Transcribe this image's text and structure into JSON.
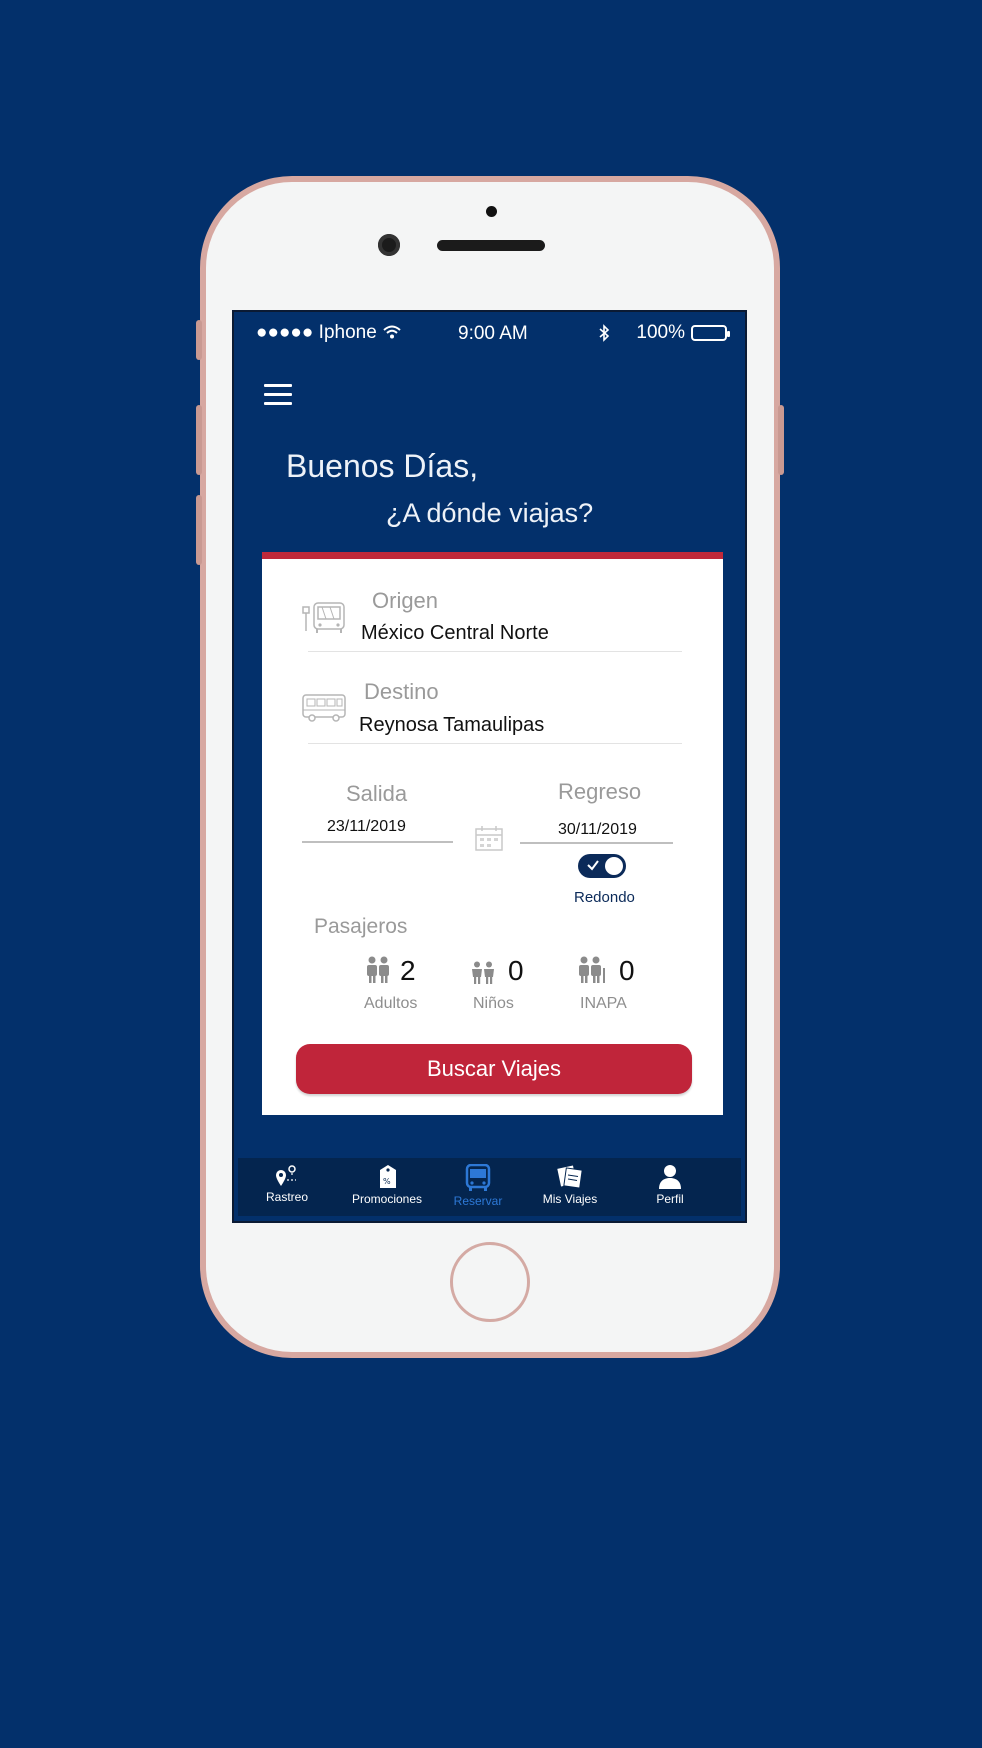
{
  "status_bar": {
    "carrier": "●●●●● Iphone",
    "time": "9:00 AM",
    "battery": "100%"
  },
  "greeting": {
    "line1": "Buenos Días,",
    "line2": "¿A dónde viajas?"
  },
  "form": {
    "origin_label": "Origen",
    "origin_value": "México Central Norte",
    "destination_label": "Destino",
    "destination_value": "Reynosa Tamaulipas",
    "departure_label": "Salida",
    "departure_value": "23/11/2019",
    "return_label": "Regreso",
    "return_value": "30/11/2019",
    "round_trip_label": "Redondo",
    "round_trip_on": true,
    "passengers_label": "Pasajeros",
    "passengers": [
      {
        "label": "Adultos",
        "count": "2"
      },
      {
        "label": "Niños",
        "count": "0"
      },
      {
        "label": "INAPA",
        "count": "0"
      }
    ],
    "search_label": "Buscar Viajes"
  },
  "tabs": [
    {
      "label": "Rastreo",
      "icon": "location-pin-icon",
      "active": false
    },
    {
      "label": "Promociones",
      "icon": "discount-tag-icon",
      "active": false
    },
    {
      "label": "Reservar",
      "icon": "bus-icon",
      "active": true
    },
    {
      "label": "Mis Viajes",
      "icon": "tickets-icon",
      "active": false
    },
    {
      "label": "Perfil",
      "icon": "user-icon",
      "active": false
    }
  ],
  "colors": {
    "background": "#03306b",
    "accent_red": "#c0253a",
    "active_tab": "#2d78d6",
    "phone_frame": "#d7a8a1"
  }
}
